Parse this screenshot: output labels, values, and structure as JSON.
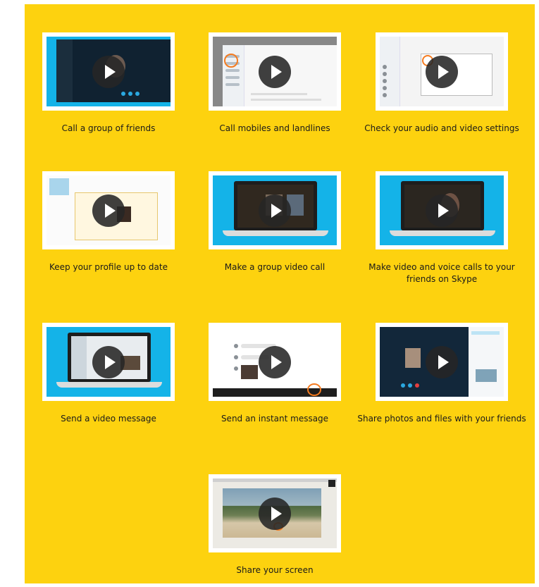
{
  "videos": [
    {
      "title": "Call a group of friends",
      "thumb": "group-call-screenshot"
    },
    {
      "title": "Call mobiles and landlines",
      "thumb": "landline-call-screenshot"
    },
    {
      "title": "Check your audio and video settings",
      "thumb": "audio-video-settings-screenshot"
    },
    {
      "title": "Keep your profile up to date",
      "thumb": "profile-screenshot"
    },
    {
      "title": "Make a group video call",
      "thumb": "group-video-laptop"
    },
    {
      "title": "Make video and voice calls to your friends on Skype",
      "thumb": "video-voice-laptop"
    },
    {
      "title": "Send a video message",
      "thumb": "video-message-laptop"
    },
    {
      "title": "Send an instant message",
      "thumb": "instant-message-screenshot"
    },
    {
      "title": "Share photos and files with your friends",
      "thumb": "share-photos-screenshot"
    },
    {
      "title": "Share your screen",
      "thumb": "share-screen-screenshot"
    }
  ],
  "colors": {
    "background": "#FDD20F",
    "accent": "#F47B20",
    "skype_blue": "#14B3E8"
  },
  "icons": {
    "play": "play-icon"
  }
}
